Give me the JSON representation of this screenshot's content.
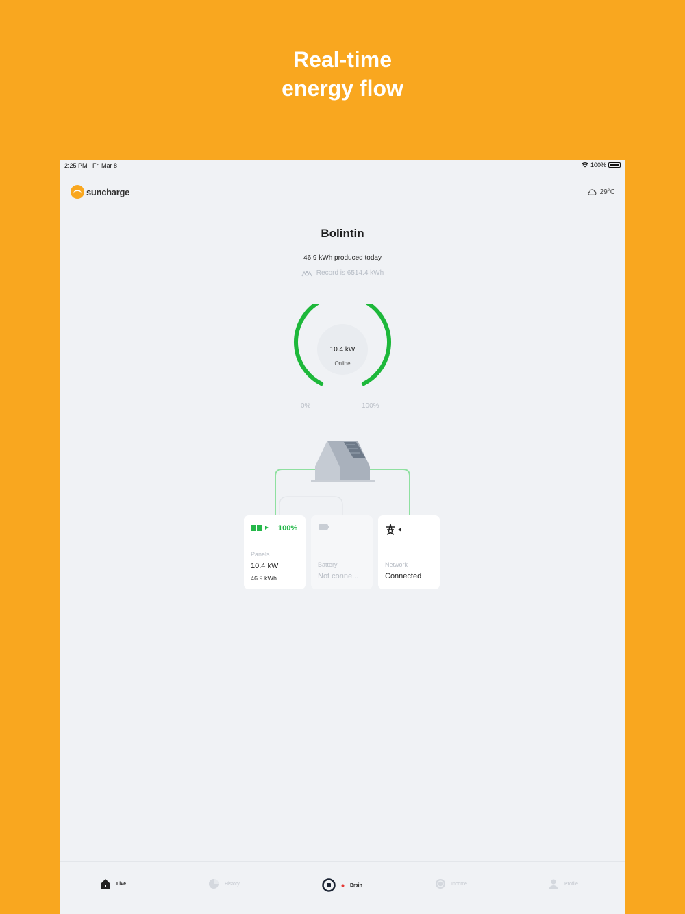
{
  "headline": {
    "line1": "Real-time",
    "line2": "energy flow"
  },
  "status_bar": {
    "time": "2:25 PM",
    "date": "Fri Mar 8",
    "battery": "100%"
  },
  "brand": {
    "name": "suncharge"
  },
  "weather": {
    "temperature": "29°C",
    "icon": "cloud-icon"
  },
  "site": {
    "name": "Bolintin",
    "produced_today": "46.9 kWh produced today",
    "record": "Record is 6514.4 kWh"
  },
  "gauge": {
    "power": "10.4 kW",
    "status": "Online",
    "min_label": "0%",
    "max_label": "100%",
    "level_percent": 100,
    "color": "#1DB83A"
  },
  "cards": {
    "panels": {
      "percent": "100%",
      "label": "Panels",
      "power": "10.4 kW",
      "energy": "46.9 kWh",
      "icon": "solar-panel-icon"
    },
    "battery": {
      "label": "Battery",
      "value": "Not conne...",
      "icon": "battery-icon"
    },
    "network": {
      "label": "Network",
      "value": "Connected",
      "icon": "power-tower-icon"
    }
  },
  "tabs": [
    {
      "label": "Live",
      "icon": "home-icon",
      "active": true
    },
    {
      "label": "History",
      "icon": "pie-chart-icon",
      "active": false
    },
    {
      "label": "Brain",
      "icon": "brain-icon",
      "active": true
    },
    {
      "label": "Income",
      "icon": "coin-icon",
      "active": false
    },
    {
      "label": "Profile",
      "icon": "user-icon",
      "active": false
    }
  ],
  "colors": {
    "background": "#F9A71F",
    "accent_green": "#1DB83A",
    "app_bg": "#F0F2F5"
  }
}
